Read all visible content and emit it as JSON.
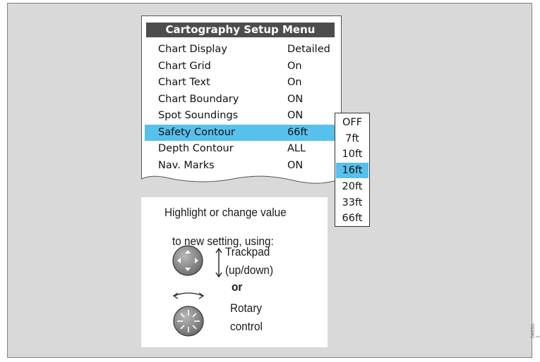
{
  "figure": {
    "doc_code": "D6550-1"
  },
  "menu": {
    "title": "Cartography Setup Menu",
    "rows": [
      {
        "label": "Chart Display",
        "value": "Detailed",
        "selected": false
      },
      {
        "label": "Chart Grid",
        "value": "On",
        "selected": false
      },
      {
        "label": "Chart Text",
        "value": "On",
        "selected": false
      },
      {
        "label": "Chart Boundary",
        "value": "ON",
        "selected": false
      },
      {
        "label": "Spot Soundings",
        "value": "ON",
        "selected": false
      },
      {
        "label": "Safety Contour",
        "value": "66ft",
        "selected": true
      },
      {
        "label": "Depth Contour",
        "value": "ALL",
        "selected": false
      },
      {
        "label": "Nav. Marks",
        "value": "ON",
        "selected": false
      }
    ]
  },
  "dropdown": {
    "options": [
      "OFF",
      "7ft",
      "10ft",
      "16ft",
      "20ft",
      "33ft",
      "66ft"
    ],
    "selected": "16ft"
  },
  "instructions": {
    "line1": "Highlight or change value",
    "line2": "to new setting, using:",
    "trackpad_label_1": "Trackpad",
    "trackpad_label_2": "(up/down)",
    "or_label": "or",
    "rotary_label_1": "Rotary",
    "rotary_label_2": "control"
  },
  "colors": {
    "background": "#d9d9d9",
    "title_bar": "#4d4d4d",
    "highlight": "#58c0ec"
  }
}
